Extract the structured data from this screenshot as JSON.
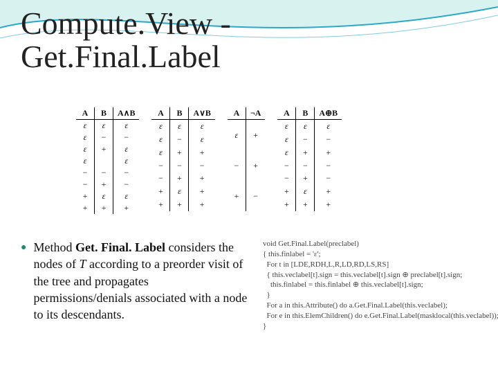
{
  "title_line1": "Compute.View -",
  "title_line2": " Get.Final.Label",
  "tables": {
    "and": {
      "head": [
        "A",
        "B",
        "A∧B"
      ],
      "rows": [
        [
          "ε",
          "ε",
          "ε"
        ],
        [
          "ε",
          "−",
          "−"
        ],
        [
          "ε",
          "+",
          "ε"
        ],
        [
          "ε",
          "",
          "ε"
        ],
        [
          "−",
          "−",
          "−"
        ],
        [
          "−",
          "+",
          "−"
        ],
        [
          "+",
          "ε",
          "ε"
        ],
        [
          "+",
          "+",
          "+"
        ]
      ]
    },
    "or": {
      "head": [
        "A",
        "B",
        "A∨B"
      ],
      "rows": [
        [
          "ε",
          "ε",
          "ε"
        ],
        [
          "ε",
          "−",
          "ε"
        ],
        [
          "ε",
          "+",
          "+"
        ],
        [
          "−",
          "−",
          "−"
        ],
        [
          "−",
          "+",
          "+"
        ],
        [
          "+",
          "ε",
          "+"
        ],
        [
          "+",
          "+",
          "+"
        ]
      ]
    },
    "not": {
      "head": [
        "A",
        "¬A"
      ],
      "rows": [
        [
          "ε",
          "+"
        ],
        [
          "−",
          "+"
        ],
        [
          "+",
          "−"
        ]
      ]
    },
    "oplus": {
      "head": [
        "A",
        "B",
        "A⊕B"
      ],
      "rows": [
        [
          "ε",
          "ε",
          "ε"
        ],
        [
          "ε",
          "−",
          "−"
        ],
        [
          "ε",
          "+",
          "+"
        ],
        [
          "−",
          "−",
          "−"
        ],
        [
          "−",
          "+",
          "−"
        ],
        [
          "+",
          "ε",
          "+"
        ],
        [
          "+",
          "+",
          "+"
        ]
      ]
    }
  },
  "bullet": {
    "prefix": "Method ",
    "bold": "Get. Final. Label",
    "rest1": " considers the nodes of ",
    "italic": "T",
    "rest2": " according to a preorder visit of the tree and propagates permissions/denials associated with a node to its descendants."
  },
  "code_lines": [
    "void Get.Final.Label(preclabel)",
    "{ this.finlabel = 'ε';",
    "  For t in [LDE,RDH,L,R,LD,RD,LS,RS]",
    "  { this.veclabel[t].sign = this.veclabel[t].sign ⊕ preclabel[t].sign;",
    "    this.finlabel = this.finlabel ⊕ this.veclabel[t].sign;",
    "  }",
    "  For a in this.Attribute() do a.Get.Final.Label(this.veclabel);",
    "  For e in this.ElemChildren() do e.Get.Final.Label(masklocal(this.veclabel));",
    "}"
  ]
}
